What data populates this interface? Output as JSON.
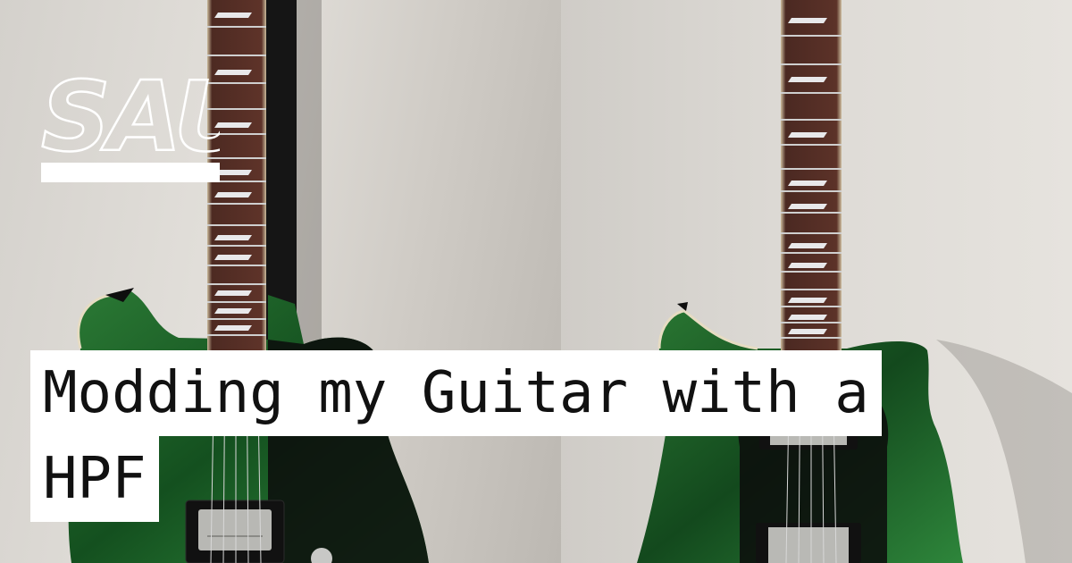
{
  "brand": {
    "logo_text": "SAUCE",
    "colors": {
      "logo": "#ffffff",
      "title_bg": "#ffffff",
      "title_text": "#111111",
      "guitar_body": "#1f6b2e",
      "fretboard": "#5a2f26"
    }
  },
  "hero": {
    "image_description_icon": "guitar-photo",
    "title_line_1": "Modding my Guitar with a",
    "title_line_2": "HPF"
  }
}
